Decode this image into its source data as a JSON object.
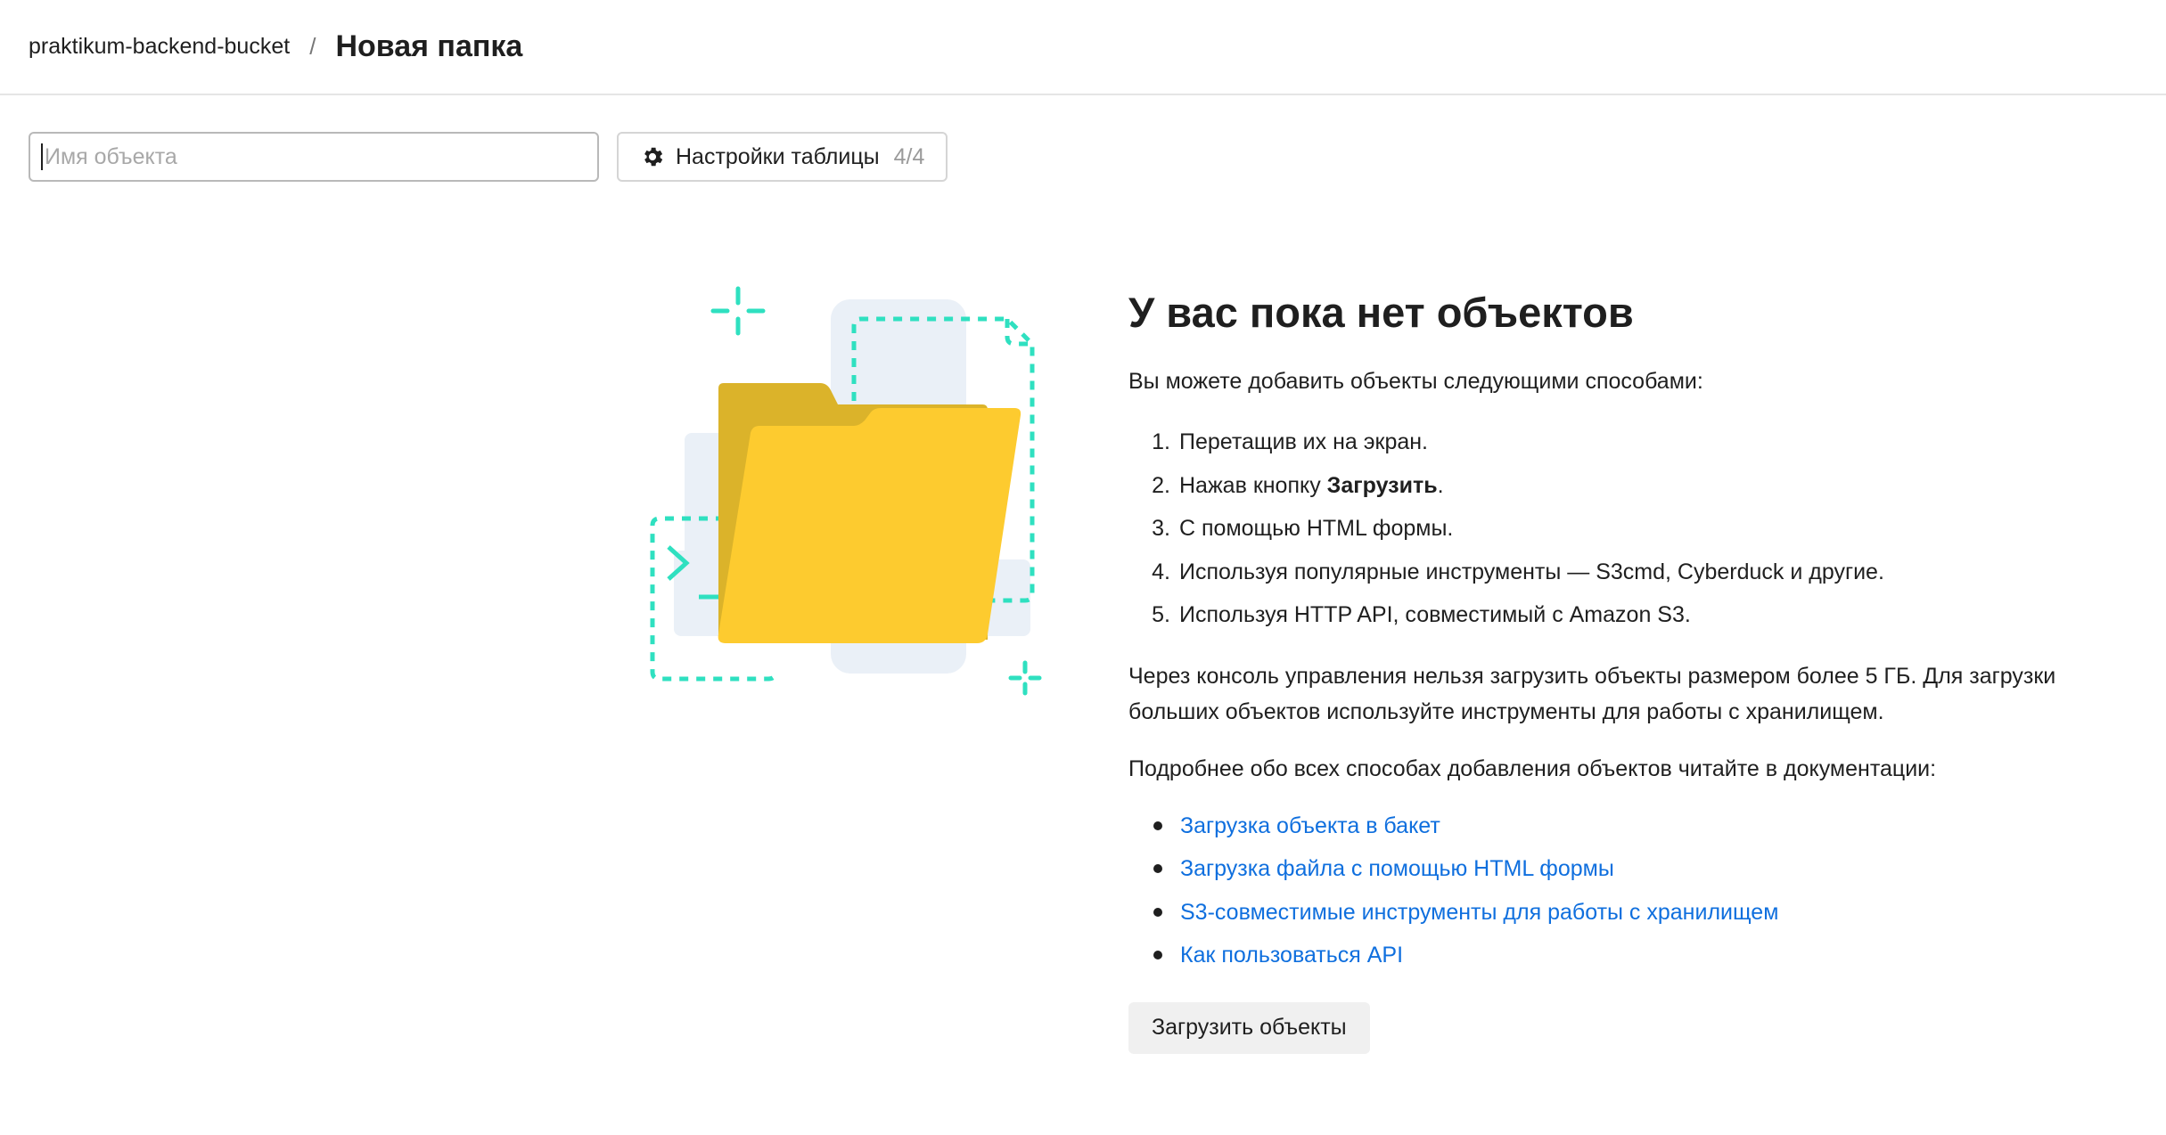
{
  "breadcrumb": {
    "bucket": "praktikum-backend-bucket",
    "separator": "/",
    "current": "Новая папка"
  },
  "toolbar": {
    "search_placeholder": "Имя объекта",
    "search_value": "",
    "settings_label": "Настройки таблицы",
    "settings_count": "4/4"
  },
  "empty_state": {
    "title": "У вас пока нет объектов",
    "intro": "Вы можете добавить объекты следующими способами:",
    "methods": [
      {
        "num": "1.",
        "before": "Перетащив их на экран.",
        "bold": "",
        "after": ""
      },
      {
        "num": "2.",
        "before": "Нажав кнопку ",
        "bold": "Загрузить",
        "after": "."
      },
      {
        "num": "3.",
        "before": "С помощью HTML формы.",
        "bold": "",
        "after": ""
      },
      {
        "num": "4.",
        "before": "Используя популярные инструменты — S3cmd, Cyberduck и другие.",
        "bold": "",
        "after": ""
      },
      {
        "num": "5.",
        "before": "Используя HTTP API, совместимый с Amazon S3.",
        "bold": "",
        "after": ""
      }
    ],
    "limit_text": "Через консоль управления нельзя загрузить объекты размером более 5 ГБ. Для загрузки больших объектов используйте инструменты для работы с хранилищем.",
    "docs_intro": "Подробнее обо всех способах добавления объектов читайте в документации:",
    "links": [
      "Загрузка объекта в бакет",
      "Загрузка файла с помощью HTML формы",
      "S3-совместимые инструменты для работы с хранилищем",
      "Как пользоваться API"
    ],
    "upload_button": "Загрузить объекты"
  },
  "icons": {
    "settings": "gear-icon",
    "illustration": "folder-illustration"
  },
  "colors": {
    "link": "#0f6fde",
    "folder_front": "#fdcb2f",
    "folder_back": "#dbb32a",
    "accent_dashed": "#2fe0c0",
    "paper_bg": "#eaf0f7"
  }
}
